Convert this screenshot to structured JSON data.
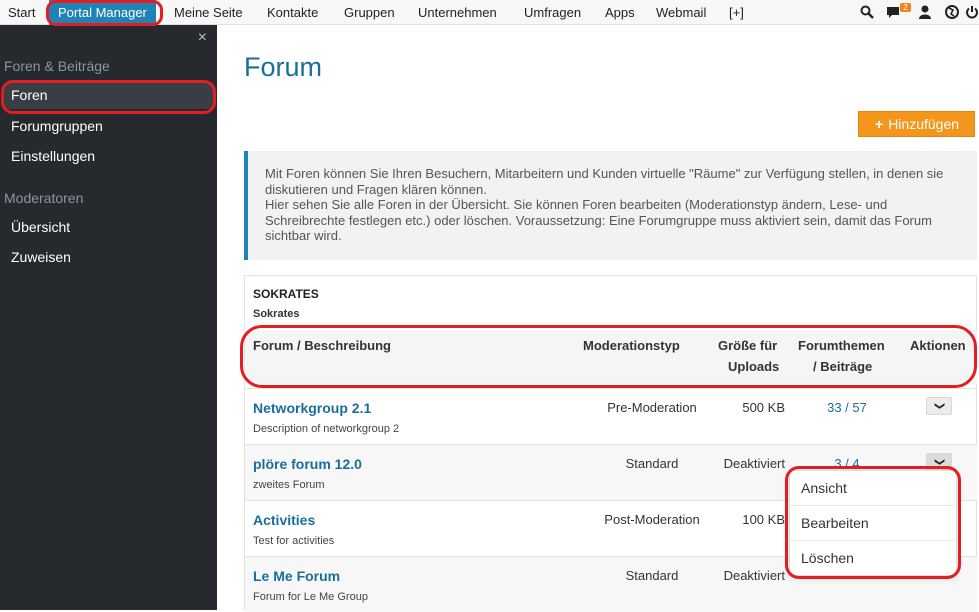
{
  "topnav": {
    "items": [
      "Start",
      "Portal Manager",
      "Meine Seite",
      "Kontakte",
      "Gruppen",
      "Unternehmen",
      "Umfragen",
      "Apps",
      "Webmail",
      "[+]"
    ],
    "messages_badge": "2",
    "icons": [
      "search-icon",
      "chat-icon",
      "user-icon",
      "globe-icon",
      "power-icon"
    ]
  },
  "sidebar": {
    "close": "×",
    "section1": "Foren & Beiträge",
    "items1": [
      "Foren",
      "Forumgruppen",
      "Einstellungen"
    ],
    "section2": "Moderatoren",
    "items2": [
      "Übersicht",
      "Zuweisen"
    ]
  },
  "main": {
    "title": "Forum",
    "add_button": "Hinzufügen",
    "info_line1": "Mit Foren können Sie Ihren Besuchern, Mitarbeitern und Kunden virtuelle \"Räume\" zur Verfügung stellen, in denen sie diskutieren und Fragen klären können.",
    "info_line2": "Hier sehen Sie alle Foren in der Übersicht. Sie können Foren bearbeiten (Moderationstyp ändern, Lese- und Schreibrechte festlegen etc.) oder löschen. Voraussetzung: Eine Forumgruppe muss aktiviert sein, damit das Forum sichtbar wird."
  },
  "panel": {
    "group_name": "SOKRATES",
    "group_sub": "Sokrates",
    "headers": {
      "forum": "Forum / Beschreibung",
      "mod": "Moderationstyp",
      "size1": "Größe für",
      "size2": "Uploads",
      "threads1": "Forumthemen",
      "threads2": "/ Beiträge",
      "actions": "Aktionen"
    },
    "rows": [
      {
        "name": "Networkgroup 2.1",
        "desc": "Description of networkgroup 2",
        "mod": "Pre-Moderation",
        "size": "500 KB",
        "threads": "33 / 57"
      },
      {
        "name": "plöre forum 12.0",
        "desc": "zweites Forum",
        "mod": "Standard",
        "size": "Deaktiviert",
        "threads": "3 / 4"
      },
      {
        "name": "Activities",
        "desc": "Test for activities",
        "mod": "Post-Moderation",
        "size": "100 KB",
        "threads": ""
      },
      {
        "name": "Le Me Forum",
        "desc": "Forum for Le Me Group",
        "mod": "Standard",
        "size": "Deaktiviert",
        "threads": ""
      }
    ]
  },
  "dropdown": {
    "items": [
      "Ansicht",
      "Bearbeiten",
      "Löschen"
    ]
  },
  "colors": {
    "accent": "#1d84b5",
    "sidebar": "#26292d",
    "add_button": "#f4951c",
    "annotation": "#e41d23"
  }
}
